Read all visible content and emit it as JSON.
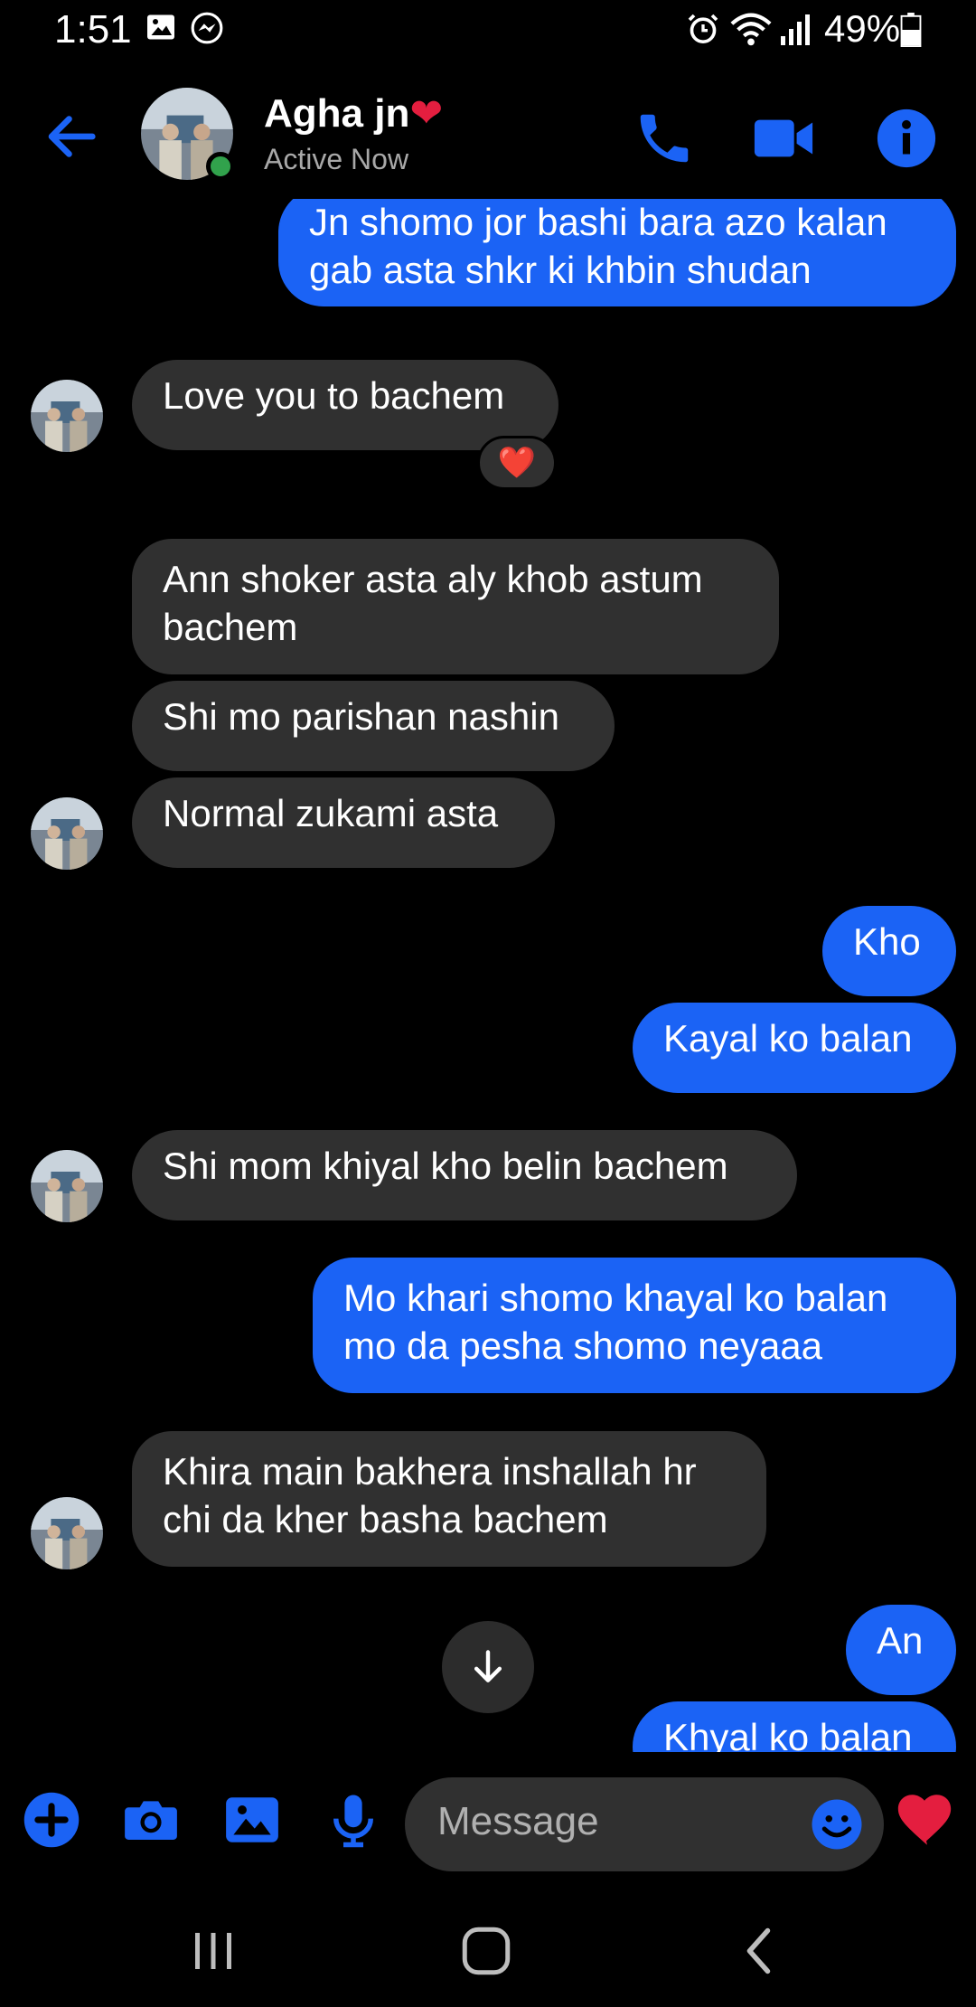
{
  "status_bar": {
    "time": "1:51",
    "battery": "49%",
    "icons": [
      "gallery-icon",
      "messenger-icon",
      "alarm-icon",
      "wifi-icon",
      "signal-icon",
      "battery-icon"
    ]
  },
  "header": {
    "contact_name": "Agha jn",
    "name_emoji": "❤️",
    "status": "Active Now",
    "icons": [
      "back-arrow-icon",
      "phone-icon",
      "video-icon",
      "info-icon"
    ]
  },
  "messages": [
    {
      "from": "me",
      "text": "Jn shomo jor bashi bara azo kalan\ngab asta shkr ki khbin shudan"
    },
    {
      "from": "them",
      "text": "Love you to bachem",
      "reaction": "❤️"
    },
    {
      "from": "them",
      "text": "Ann shoker asta  aly khob astum\nbachem"
    },
    {
      "from": "them",
      "text": "Shi mo parishan nashin"
    },
    {
      "from": "them",
      "text": "Normal zukami asta"
    },
    {
      "from": "me",
      "text": "Kho"
    },
    {
      "from": "me",
      "text": "Kayal ko balan"
    },
    {
      "from": "them",
      "text": "Shi mom khiyal kho belin bachem"
    },
    {
      "from": "me",
      "text": "Mo khari shomo khayal ko balan\nmo da pesha shomo neyaaa"
    },
    {
      "from": "them",
      "text": "Khira main bakhera inshallah  hr\nchi da kher basha bachem"
    },
    {
      "from": "me",
      "text": "An"
    },
    {
      "from": "me",
      "text": "Khyal ko balan"
    }
  ],
  "composer": {
    "placeholder": "Message",
    "icons": [
      "plus-icon",
      "camera-icon",
      "gallery-icon",
      "microphone-icon",
      "emoji-icon",
      "heart-icon"
    ]
  },
  "colors": {
    "accent": "#1b63f5",
    "incoming_bubble": "#303030",
    "background": "#000000",
    "online": "#31a24c",
    "heart": "#e41e3f"
  }
}
